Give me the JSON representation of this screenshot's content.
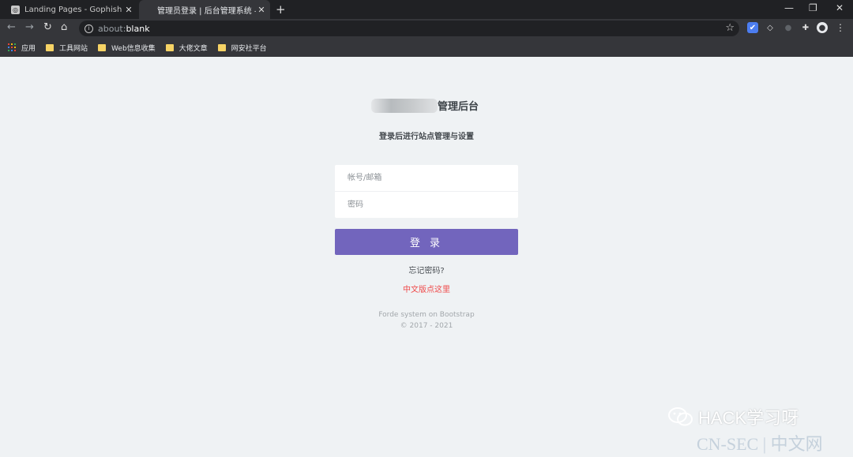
{
  "tabs": [
    {
      "title": "Landing Pages - Gophish",
      "close": "✕"
    },
    {
      "title": "管理员登录 | 后台管理系统 — Pr",
      "close": "✕"
    }
  ],
  "new_tab": "+",
  "window_controls": {
    "minimize": "—",
    "restore": "❐",
    "close": "✕"
  },
  "nav": {
    "back": "←",
    "forward": "→",
    "reload": "↻",
    "home": "⌂"
  },
  "address": {
    "prefix": "about:",
    "rest": "blank"
  },
  "bookmarks": {
    "apps_label": "应用",
    "items": [
      "工具网站",
      "Web信息收集",
      "大佬文章",
      "网安社平台"
    ]
  },
  "login": {
    "brand_suffix": "管理后台",
    "subtitle": "登录后进行站点管理与设置",
    "username_placeholder": "帐号/邮箱",
    "password_placeholder": "密码",
    "submit": "登 录",
    "forgot": "忘记密码?",
    "chinese_link": "中文版点这里",
    "footer_line1": "Forde system on Bootstrap",
    "footer_line2": "© 2017 - 2021"
  },
  "watermark": {
    "main": "HACK学习呀",
    "site": "CN-SEC | 中文网"
  },
  "colors": {
    "accent": "#7265bd",
    "link_red": "#ef4a4a",
    "page_bg": "#eff2f4"
  }
}
